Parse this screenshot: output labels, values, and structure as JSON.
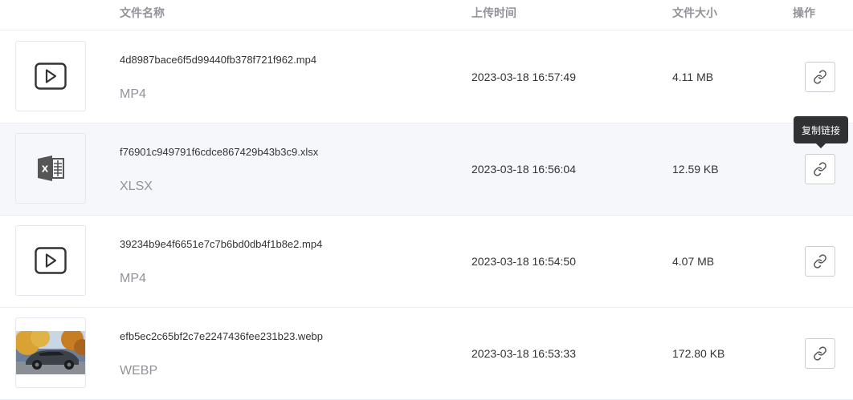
{
  "header": {
    "col_name": "文件名称",
    "col_time": "上传时间",
    "col_size": "文件大小",
    "col_op": "操作"
  },
  "tooltip": "复制链接",
  "rows": [
    {
      "name": "4d8987bace6f5d99440fb378f721f962.mp4",
      "type": "MP4",
      "time": "2023-03-18 16:57:49",
      "size": "4.11 MB",
      "icon": "video-play-icon"
    },
    {
      "name": "f76901c949791f6cdce867429b43b3c9.xlsx",
      "type": "XLSX",
      "time": "2023-03-18 16:56:04",
      "size": "12.59 KB",
      "icon": "excel-icon"
    },
    {
      "name": "39234b9e4f6651e7c7b6bd0db4f1b8e2.mp4",
      "type": "MP4",
      "time": "2023-03-18 16:54:50",
      "size": "4.07 MB",
      "icon": "video-play-icon"
    },
    {
      "name": "efb5ec2c65bf2c7e2247436fee231b23.webp",
      "type": "WEBP",
      "time": "2023-03-18 16:53:33",
      "size": "172.80 KB",
      "icon": "image-thumbnail"
    }
  ]
}
